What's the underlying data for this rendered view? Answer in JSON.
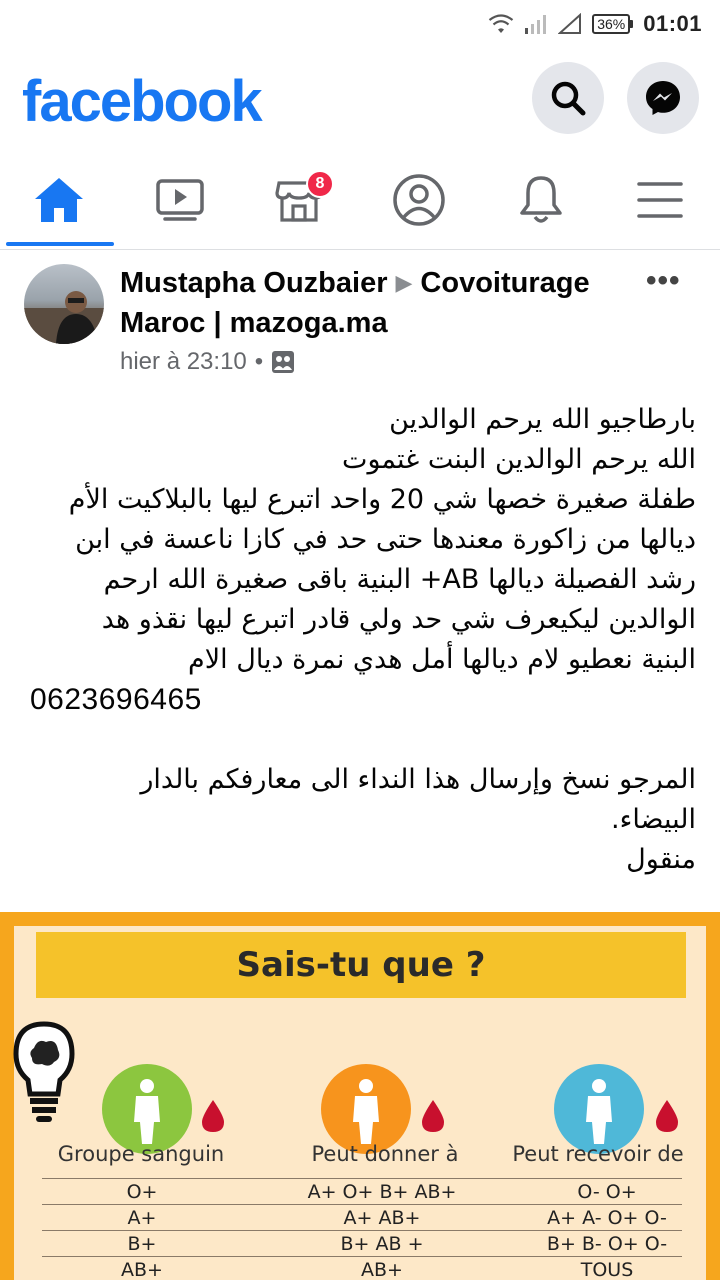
{
  "status_bar": {
    "battery": "36%",
    "time": "01:01"
  },
  "header": {
    "logo": "facebook"
  },
  "nav": {
    "marketplace_badge": "8"
  },
  "post": {
    "author": "Mustapha Ouzbaier",
    "group_line1": "Covoiturage",
    "group_line2": "Maroc | mazoga.ma",
    "timestamp": "hier à 23:10",
    "more": "•••",
    "text_lines": [
      "بارطاجيو الله يرحم الوالدين",
      "الله يرحم الوالدين البنت غتموت",
      "طفلة صغيرة خصها شي 20 واحد اتبرع ليها بالبلاكيت الأم",
      "ديالها من زاكورة معندها حتى حد في كازا ناعسة في ابن",
      "رشد الفصيلة ديالها AB+ البنية باقى صغيرة الله ارحم",
      "الوالدين ليكيعرف شي حد ولي قادر اتبرع ليها نقذو هد",
      "البنية نعطيو لام ديالها أمل هدي نمرة ديال الام"
    ],
    "phone": "0623696465",
    "text_lines_2": [
      "المرجو نسخ وإرسال هذا النداء الى معارفكم بالدار",
      "البيضاء.",
      "منقول"
    ]
  },
  "infographic": {
    "title": "Sais-tu que ?",
    "col_headers": [
      "Groupe sanguin",
      "Peut donner à",
      "Peut recevoir de"
    ],
    "rows": [
      [
        "O+",
        "A+ O+ B+ AB+",
        "O- O+"
      ],
      [
        "A+",
        "A+ AB+",
        "A+ A- O+ O-"
      ],
      [
        "B+",
        "B+ AB +",
        "B+ B- O+ O-"
      ],
      [
        "AB+",
        "AB+",
        "TOUS"
      ]
    ],
    "colors": {
      "green": "#8cc63f",
      "orange": "#f7941d",
      "blue": "#4fb8d8",
      "drop": "#c8102e"
    }
  }
}
